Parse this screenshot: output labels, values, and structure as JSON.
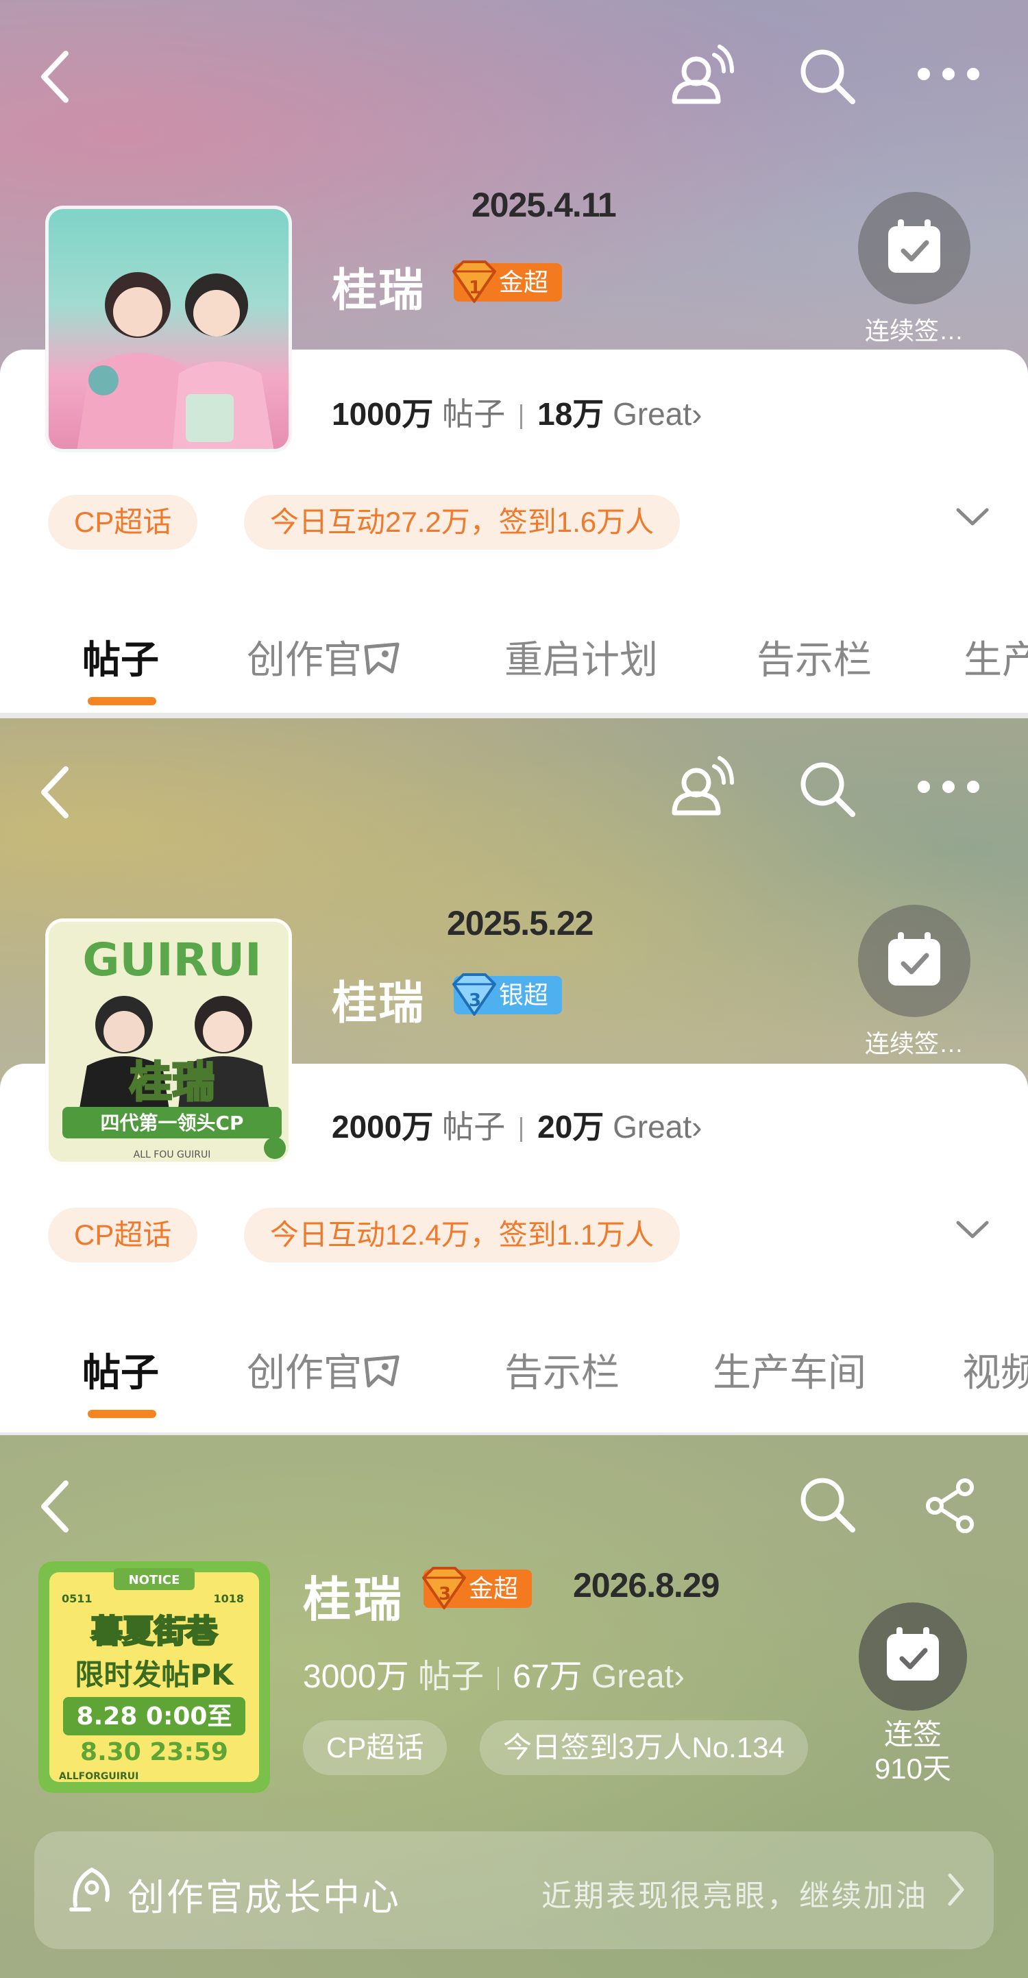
{
  "screens": [
    {
      "date": "2025.4.11",
      "title": "桂瑞",
      "badge": "金超",
      "signin_label": "连续签…",
      "posts_value": "1000万",
      "posts_label": "帖子",
      "great_value": "18万",
      "great_label": "Great",
      "tag": "CP超话",
      "activity": "今日互动27.2万，签到1.6万人",
      "tabs": [
        "帖子",
        "创作官",
        "重启计划",
        "告示栏",
        "生产"
      ]
    },
    {
      "date": "2025.5.22",
      "title": "桂瑞",
      "badge": "银超",
      "signin_label": "连续签…",
      "posts_value": "2000万",
      "posts_label": "帖子",
      "great_value": "20万",
      "great_label": "Great",
      "tag": "CP超话",
      "activity": "今日互动12.4万，签到1.1万人",
      "tabs": [
        "帖子",
        "创作官",
        "告示栏",
        "生产车间",
        "视频"
      ],
      "avatar_text": {
        "top": "GUIRUI",
        "name": "桂瑞",
        "ribbon": "四代第一领头CP",
        "bottom": "ALL FOU GUIRUI"
      }
    },
    {
      "date": "2026.8.29",
      "title": "桂瑞",
      "badge": "金超",
      "posts_value": "3000万",
      "posts_label": "帖子",
      "great_value": "67万",
      "great_label": "Great",
      "tag": "CP超话",
      "activity": "今日签到3万人No.134",
      "signin_label_1": "连签",
      "signin_label_2": "910天",
      "growth_title": "创作官成长中心",
      "growth_subtitle": "近期表现很亮眼，继续加油",
      "avatar_text": {
        "notice": "NOTICE",
        "left_code": "0511",
        "right_code": "1018",
        "line1": "暮夏街巷",
        "line2": "限时发帖PK",
        "line3": "8.28 0:00至",
        "line4": "8.30 23:59",
        "bottom": "ALLFORGUIRUI"
      }
    }
  ],
  "colors": {
    "accent": "#f6851f",
    "tag_bg": "#fdeee4",
    "tag_text": "#f07a2b",
    "gold_badge": "#f47a20",
    "silver_badge": "#4fb0f0"
  },
  "icons": [
    "back-icon",
    "bot-chat-icon",
    "search-icon",
    "more-icon",
    "share-icon",
    "calendar-check-icon",
    "chevron-down-icon",
    "chevron-right-icon",
    "creator-icon"
  ]
}
